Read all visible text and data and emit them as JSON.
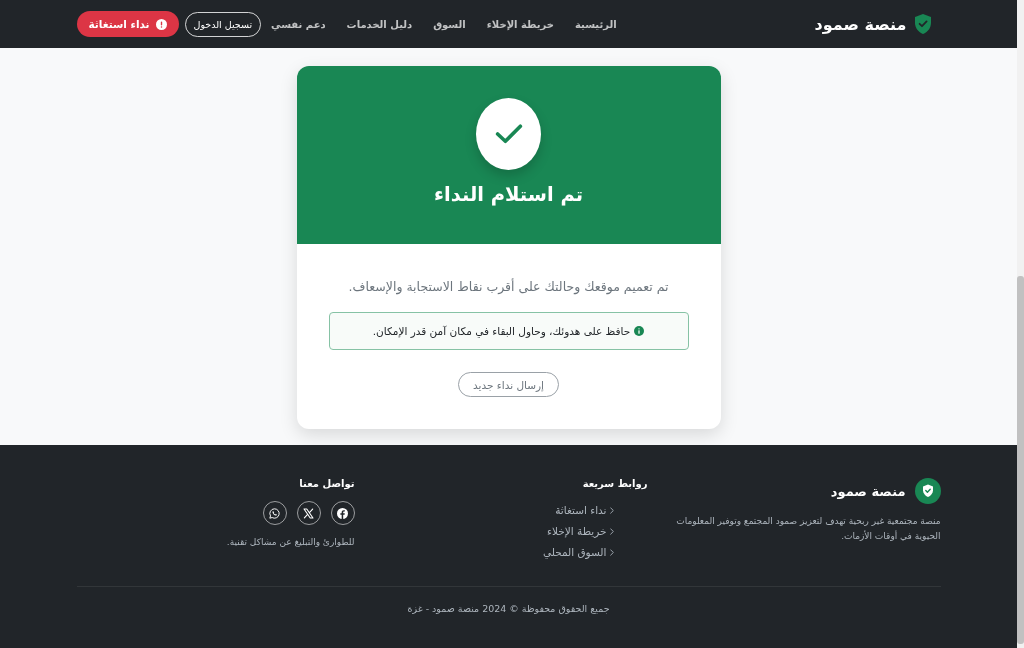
{
  "navbar": {
    "brand": "منصة صمود",
    "links": [
      {
        "label": "الرئيسية"
      },
      {
        "label": "خريطة الإخلاء"
      },
      {
        "label": "السوق"
      },
      {
        "label": "دليل الخدمات"
      },
      {
        "label": "دعم نفسي"
      }
    ],
    "login_button": "تسجيل الدخول",
    "emergency_button": "نداء استغاثة"
  },
  "confirmation_card": {
    "title": "تم استلام النداء",
    "message": "تم تعميم موقعك وحالتك على أقرب نقاط الاستجابة والإسعاف.",
    "notice": "حافظ على هدوئك، وحاول البقاء في مكان آمن قدر الإمكان.",
    "button": "إرسال نداء جديد"
  },
  "footer": {
    "about": {
      "brand": "منصة صمود",
      "description": "منصة مجتمعية غير ربحية تهدف لتعزيز صمود المجتمع وتوفير المعلومات الحيوية في أوقات الأزمات."
    },
    "quick_links": {
      "heading": "روابط سريعة",
      "links": [
        "نداء استغاثة",
        "خريطة الإخلاء",
        "السوق المحلي"
      ]
    },
    "contact": {
      "heading": "تواصل معنا",
      "socials": [
        {
          "kind": "facebook"
        },
        {
          "kind": "x"
        },
        {
          "kind": "whatsapp"
        }
      ],
      "note": "للطوارئ والتبليغ عن مشاكل تقنية."
    },
    "copyright": "جميع الحقوق محفوظة © 2024 منصة صمود - غزة"
  }
}
